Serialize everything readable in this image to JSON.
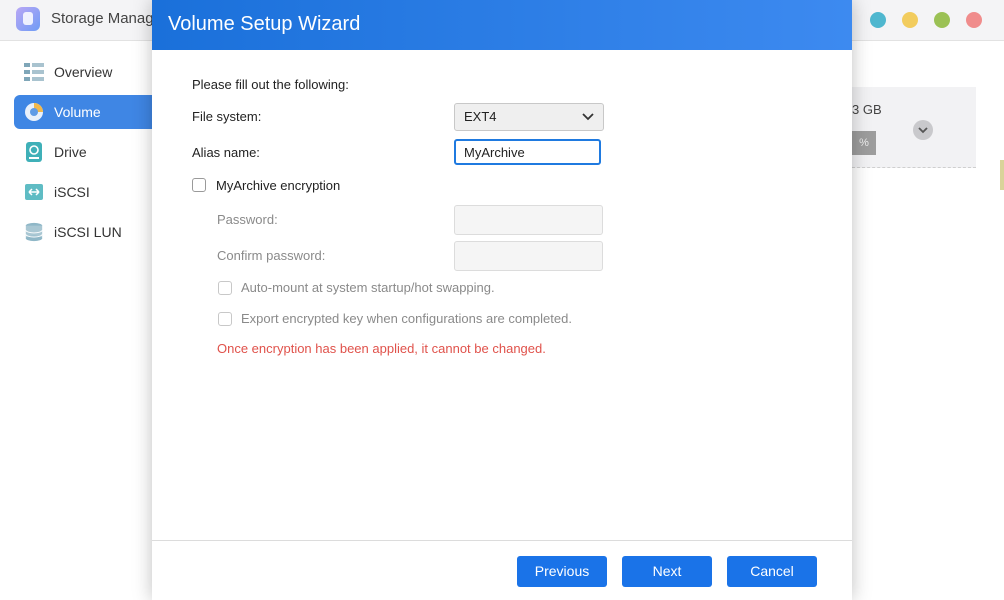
{
  "app": {
    "title": "Storage Manag",
    "window_controls": [
      {
        "name": "info",
        "color": "#4fb7cf"
      },
      {
        "name": "minimize",
        "color": "#f2cc5e"
      },
      {
        "name": "maximize",
        "color": "#9bc155"
      },
      {
        "name": "close",
        "color": "#f08c8c"
      }
    ]
  },
  "sidebar": {
    "items": [
      {
        "label": "Overview",
        "icon": "overview-icon",
        "active": false
      },
      {
        "label": "Volume",
        "icon": "volume-icon",
        "active": true
      },
      {
        "label": "Drive",
        "icon": "drive-icon",
        "active": false
      },
      {
        "label": "iSCSI",
        "icon": "iscsi-icon",
        "active": false
      },
      {
        "label": "iSCSI LUN",
        "icon": "iscsi-lun-icon",
        "active": false
      }
    ]
  },
  "background": {
    "size_text": "3 GB",
    "bar_text": "%"
  },
  "dialog": {
    "title": "Volume Setup Wizard",
    "intro": "Please fill out the following:",
    "file_system": {
      "label": "File system:",
      "value": "EXT4"
    },
    "alias": {
      "label": "Alias name:",
      "value": "MyArchive"
    },
    "encryption": {
      "label": "MyArchive encryption",
      "checked": false
    },
    "password": {
      "label": "Password:",
      "value": ""
    },
    "confirm_password": {
      "label": "Confirm password:",
      "value": ""
    },
    "auto_mount": {
      "label": "Auto-mount at system startup/hot swapping.",
      "checked": false
    },
    "export_key": {
      "label": "Export encrypted key when configurations are completed.",
      "checked": false
    },
    "warning": "Once encryption has been applied, it cannot be changed.",
    "buttons": {
      "previous": "Previous",
      "next": "Next",
      "cancel": "Cancel"
    }
  },
  "colors": {
    "header_accent": "#1a70da",
    "button": "#1a73e8",
    "warning": "#e0524b",
    "sidebar_active": "#3f86e4"
  }
}
